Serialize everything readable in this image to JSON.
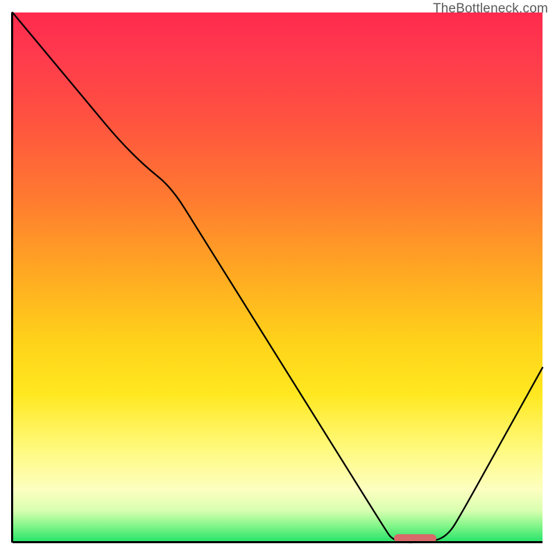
{
  "watermark": "TheBottleneck.com",
  "chart_data": {
    "type": "line",
    "title": "",
    "xlabel": "",
    "ylabel": "",
    "xlim": [
      0,
      100
    ],
    "ylim": [
      0,
      100
    ],
    "x": [
      0,
      5,
      10,
      15,
      20,
      25,
      30,
      35,
      40,
      45,
      50,
      55,
      60,
      65,
      70,
      72,
      78,
      82,
      85,
      90,
      95,
      100
    ],
    "values": [
      100,
      94,
      88,
      82,
      76,
      71,
      67,
      59,
      51,
      43,
      35,
      27,
      19,
      11,
      3,
      0,
      0,
      1,
      6,
      15,
      24,
      33
    ],
    "optimum_range": {
      "start": 72,
      "end": 80
    },
    "gradient_stops": [
      {
        "pos": 0,
        "color": "#ff2a4d"
      },
      {
        "pos": 50,
        "color": "#ffc81e"
      },
      {
        "pos": 85,
        "color": "#fdff9a"
      },
      {
        "pos": 100,
        "color": "#22e268"
      }
    ]
  }
}
